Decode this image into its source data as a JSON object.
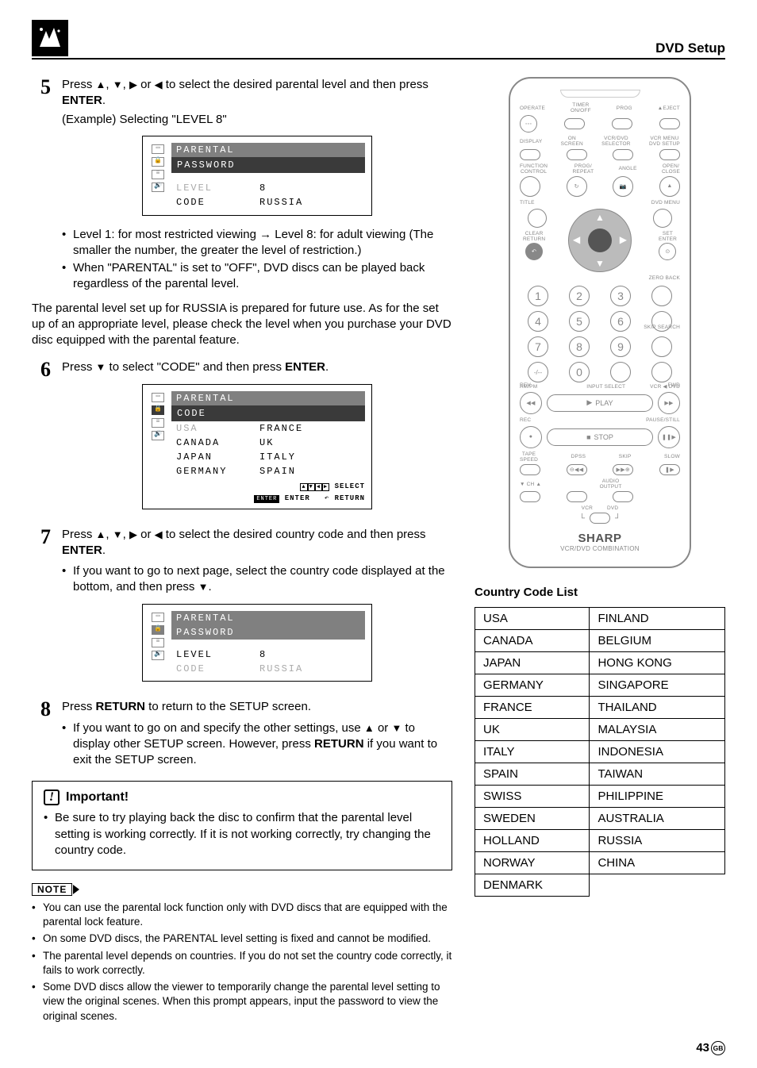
{
  "header": {
    "section_title": "DVD Setup"
  },
  "steps": {
    "s5": {
      "num": "5",
      "text_a": "Press ",
      "text_b": " to select the desired parental level and then press ",
      "enter": "ENTER",
      "period": ".",
      "example": "(Example) Selecting \"LEVEL 8\"",
      "osd": {
        "title": "PARENTAL",
        "sub": "PASSWORD",
        "level_label": "LEVEL",
        "level_value": "8",
        "code_label": "CODE",
        "code_value": "RUSSIA"
      },
      "bullets": [
        "Level 1: for most restricted viewing → Level 8: for adult viewing (The smaller the number, the greater the level of restriction.)",
        "When \"PARENTAL\" is set to \"OFF\", DVD discs can be played back regardless of the parental level."
      ],
      "para": "The parental level set up for RUSSIA is prepared for future use. As for the set up of an appropriate level, please check the level when you purchase your DVD disc equipped with the parental feature."
    },
    "s6": {
      "num": "6",
      "text_a": "Press ",
      "text_b": " to select \"CODE\" and then press ",
      "enter": "ENTER",
      "period": ".",
      "osd": {
        "title": "PARENTAL",
        "sub": "CODE",
        "rows": [
          [
            "USA",
            "FRANCE"
          ],
          [
            "CANADA",
            "UK"
          ],
          [
            "JAPAN",
            "ITALY"
          ],
          [
            "GERMANY",
            "SPAIN"
          ]
        ],
        "ctrl_select": "SELECT",
        "ctrl_enter_btn": "ENTER",
        "ctrl_enter": "ENTER",
        "ctrl_return": "RETURN"
      }
    },
    "s7": {
      "num": "7",
      "text_a": "Press ",
      "text_b": " to select the desired country code and then press ",
      "enter": "ENTER",
      "period": ".",
      "bullet": "If you want to go to next page, select the country code displayed at the bottom, and then press ",
      "bullet_end": ".",
      "osd": {
        "title": "PARENTAL",
        "sub": "PASSWORD",
        "level_label": "LEVEL",
        "level_value": "8",
        "code_label": "CODE",
        "code_value": "RUSSIA"
      }
    },
    "s8": {
      "num": "8",
      "text_a": "Press ",
      "return": "RETURN",
      "text_b": " to return to the SETUP screen.",
      "bullet_a": "If you want to go on and specify the other settings, use ",
      "bullet_b": " or ",
      "bullet_c": " to display other SETUP screen. However, press ",
      "bullet_d": " if you want to exit the SETUP screen."
    }
  },
  "important": {
    "title": "Important!",
    "text": "Be sure to try playing back the disc to confirm that the parental level setting is working correctly. If it is not working correctly, try changing the country code."
  },
  "note": {
    "label": "NOTE",
    "items": [
      "You can use the parental lock function only with DVD discs that are equipped with the parental lock feature.",
      "On some DVD discs, the PARENTAL level setting is fixed and cannot be modified.",
      "The parental level depends on countries. If you do not set the country code correctly, it fails to work correctly.",
      "Some DVD discs allow the viewer to temporarily change the parental level setting to view the original scenes. When this prompt appears, input the password to view the original scenes."
    ]
  },
  "remote": {
    "labels": {
      "operate": "OPERATE",
      "timer": "TIMER\nON/OFF",
      "prog": "PROG",
      "eject": "▲EJECT",
      "display": "DISPLAY",
      "onscreen": "ON\nSCREEN",
      "vcrdvdsel": "VCR/DVD\nSELECTOR",
      "vcrmenu": "VCR MENU\nDVD SETUP",
      "function": "FUNCTION\nCONTROL",
      "progrepeat": "PROG/\nREPEAT",
      "angle": "ANGLE",
      "openclose": "OPEN/\nCLOSE",
      "title": "TITLE",
      "dvdmenu": "DVD MENU",
      "clearreturn": "CLEAR\nRETURN",
      "setenter": "SET\nENTER",
      "zeroback": "ZERO BACK",
      "skipsearch": "SKIP SEARCH",
      "ampm": "AM/PM",
      "inputselect": "INPUT SELECT",
      "vcrdvd": "VCR ◀ DVD",
      "rev": "REV",
      "fwd": "FWD",
      "play": "PLAY",
      "rec": "REC",
      "stop": "STOP",
      "pausestill": "PAUSE/STILL",
      "tapespeed": "TAPE\nSPEED",
      "dpss": "DPSS",
      "skip": "SKIP",
      "slow": "SLOW",
      "ch": "CH",
      "audiooutput": "AUDIO\nOUTPUT",
      "vcr": "VCR",
      "dvd": "DVD"
    },
    "brand": "SHARP",
    "brand_sub": "VCR/DVD COMBINATION"
  },
  "country_code_list": {
    "title": "Country Code List",
    "rows": [
      [
        "USA",
        "FINLAND"
      ],
      [
        "CANADA",
        "BELGIUM"
      ],
      [
        "JAPAN",
        "HONG KONG"
      ],
      [
        "GERMANY",
        "SINGAPORE"
      ],
      [
        "FRANCE",
        "THAILAND"
      ],
      [
        "UK",
        "MALAYSIA"
      ],
      [
        "ITALY",
        "INDONESIA"
      ],
      [
        "SPAIN",
        "TAIWAN"
      ],
      [
        "SWISS",
        "PHILIPPINE"
      ],
      [
        "SWEDEN",
        "AUSTRALIA"
      ],
      [
        "HOLLAND",
        "RUSSIA"
      ],
      [
        "NORWAY",
        "CHINA"
      ],
      [
        "DENMARK",
        ""
      ]
    ]
  },
  "page_number": "43",
  "page_region": "GB"
}
